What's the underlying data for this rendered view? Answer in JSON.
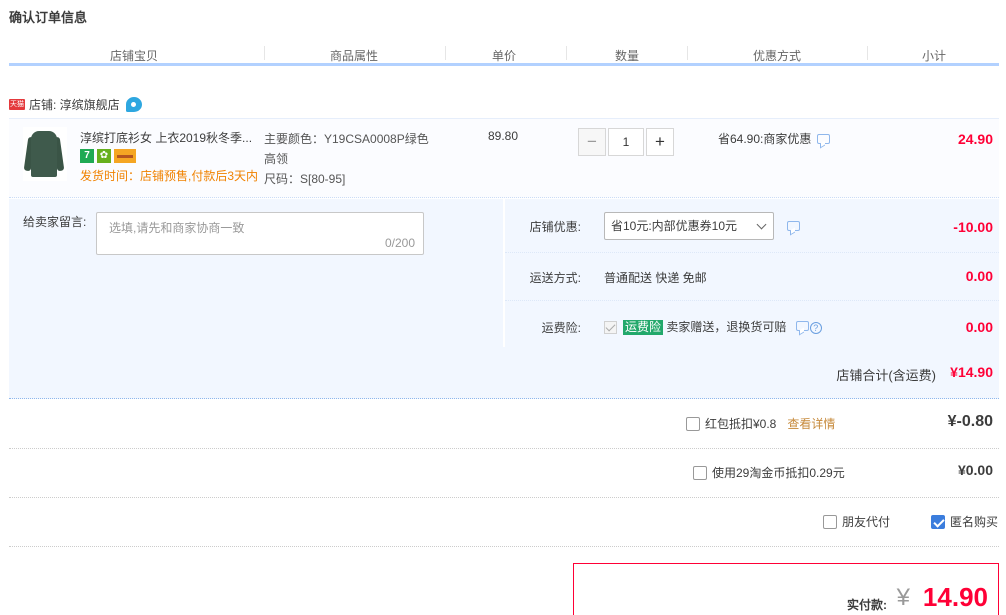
{
  "page_title": "确认订单信息",
  "columns": [
    "店铺宝贝",
    "商品属性",
    "单价",
    "数量",
    "优惠方式",
    "小计"
  ],
  "shop": {
    "tag": "天猫",
    "name": "店铺: 淳缤旗舰店"
  },
  "item": {
    "title": "淳缤打底衫女 上衣2019秋冬季...",
    "badge_7": "7",
    "ship_note": "发货时间：店铺预售,付款后3天内",
    "prop_color": "主要颜色：Y19CSA0008P绿色",
    "prop_color2": "高领",
    "prop_size": "尺码：S[80-95]",
    "unit_price": "89.80",
    "qty_minus": "−",
    "qty": "1",
    "qty_plus": "+",
    "promo": "省64.90:商家优惠",
    "subtotal": "24.90"
  },
  "message": {
    "label": "给卖家留言:",
    "placeholder": "选填,请先和商家协商一致",
    "count": "0/200"
  },
  "shop_discount": {
    "label": "店铺优惠:",
    "selected": "省10元:内部优惠券10元",
    "amount": "-10.00"
  },
  "shipping": {
    "label": "运送方式:",
    "value": "普通配送 快递 免邮",
    "amount": "0.00"
  },
  "insurance": {
    "label": "运费险:",
    "tag": "运费险",
    "text": "卖家赠送，退换货可赔",
    "help": "?",
    "amount": "0.00"
  },
  "shop_total": {
    "label": "店铺合计(含运费)",
    "amount": "¥14.90"
  },
  "redpacket": {
    "label": "红包抵扣¥0.8",
    "link": "查看详情",
    "amount": "¥-0.80"
  },
  "coins": {
    "label": "使用29淘金币抵扣0.29元",
    "amount": "¥0.00"
  },
  "friend_pay": {
    "label": "朋友代付",
    "checked": false
  },
  "anonymous": {
    "label": "匿名购买",
    "checked": true
  },
  "pay": {
    "label": "实付款:",
    "currency": "¥",
    "amount": "14.90"
  },
  "colors": {
    "accent_red": "#ff0036",
    "panel_blue": "#f2f7ff",
    "header_line": "#b2d1ff",
    "warn_orange": "#f08200",
    "check_blue": "#3b7ddd"
  }
}
